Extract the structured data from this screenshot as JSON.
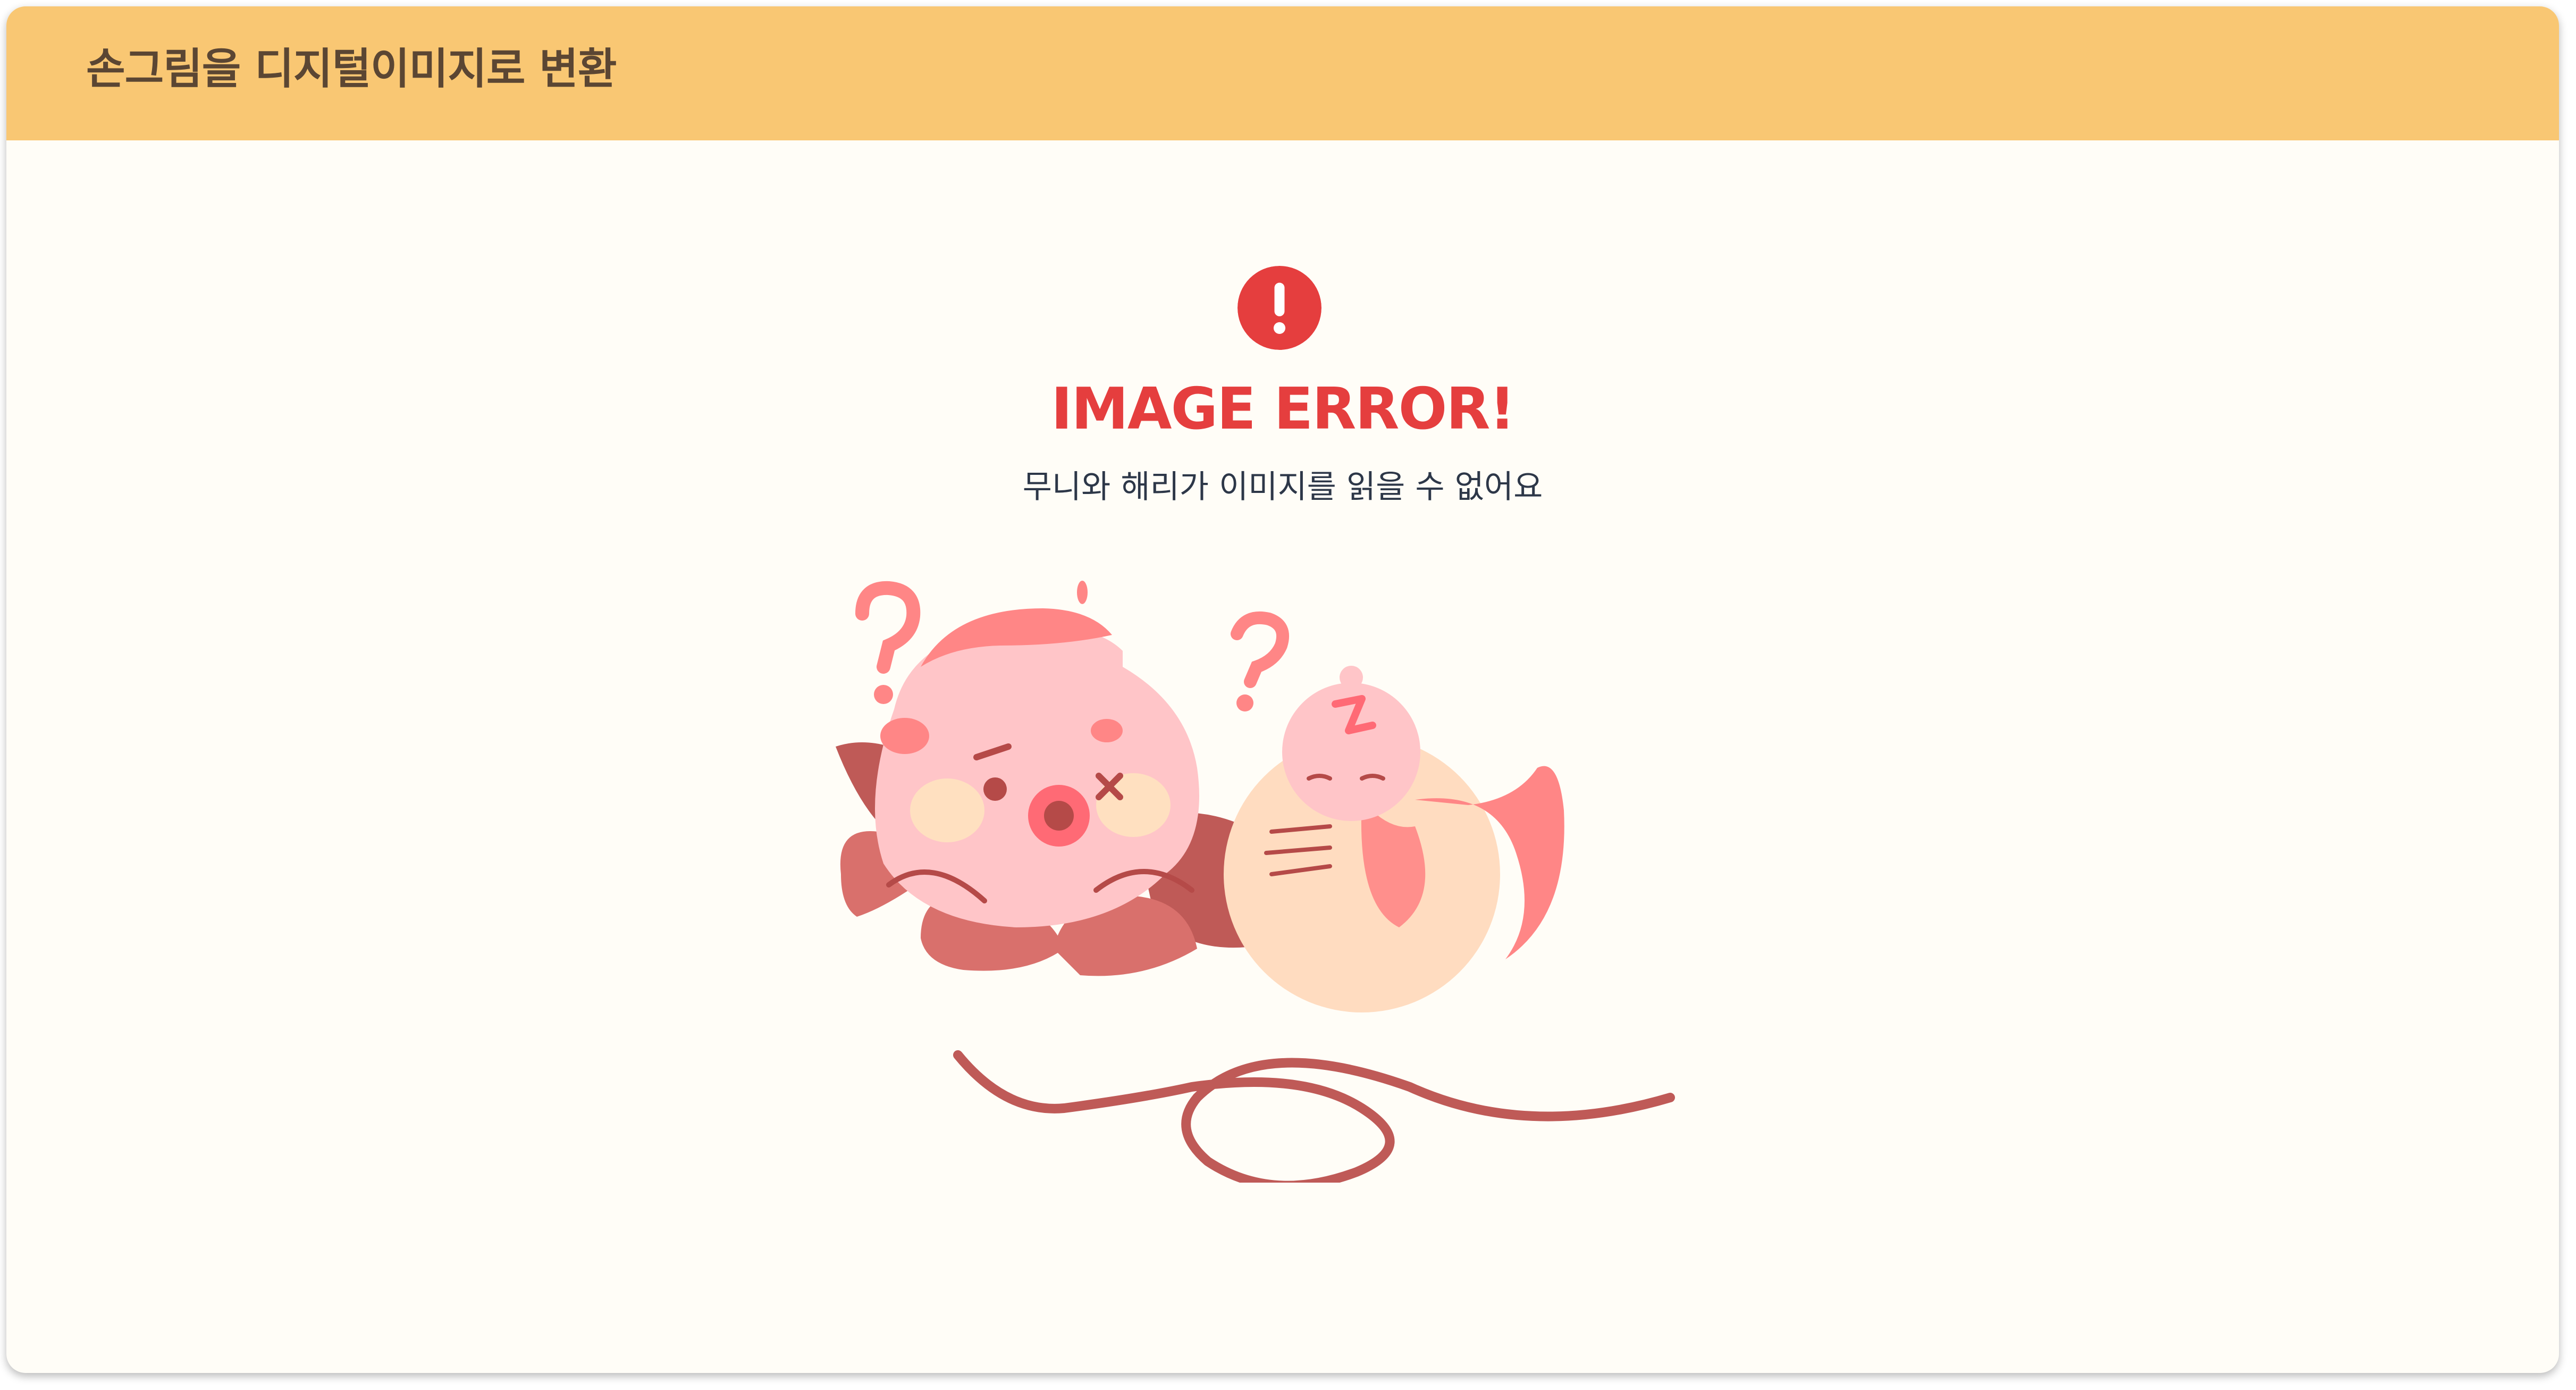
{
  "app": {
    "title": "손그림을 디지털이미지로 변환"
  },
  "error": {
    "icon": "exclamation-circle-icon",
    "title": "IMAGE ERROR!",
    "message": "무니와 해리가 이미지를 읽을 수 없어요"
  },
  "illustration": {
    "name": "confused-octopus-and-jellyfish"
  },
  "colors": {
    "header_bg": "#f9c773",
    "header_text": "#5b4633",
    "page_bg": "#fffdf7",
    "error_red": "#e53e3e",
    "subtitle_text": "#2d3748",
    "octopus_pink": "#ffc5c8",
    "accent_coral": "#ff8686",
    "dark_red": "#bf5a57"
  }
}
